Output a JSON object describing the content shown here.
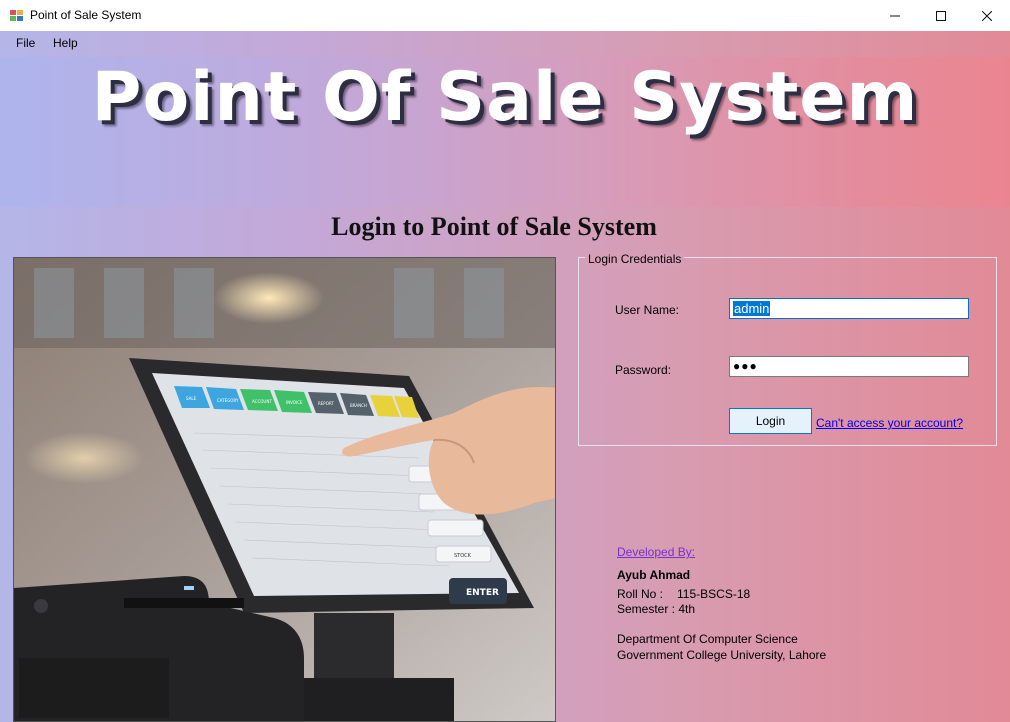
{
  "window": {
    "title": "Point of Sale System",
    "controls": {
      "minimize": "—",
      "maximize": "☐",
      "close": "✕"
    }
  },
  "menu": {
    "file": "File",
    "help": "Help"
  },
  "banner": {
    "title": "Point Of Sale System"
  },
  "heading": "Login to Point of Sale System",
  "login": {
    "group_label": "Login Credentials",
    "username_label": "User Name:",
    "username_value": "admin",
    "password_label": "Password:",
    "password_value": "●●●",
    "login_button": "Login",
    "help_link": "Can't access your account?"
  },
  "developer": {
    "heading": "Developed By:",
    "name": "Ayub Ahmad",
    "roll_label": "Roll No :",
    "roll_value": "115-BSCS-18",
    "semester": "Semester : 4th",
    "department": "Department Of Computer Science",
    "university": "Government College University, Lahore"
  },
  "pos_screen": {
    "tiles": [
      "SALE",
      "CATEGORY",
      "ACCOUNT",
      "INVOICE",
      "REPORT",
      "BRANCH",
      "ANY",
      ""
    ],
    "side_buttons": [
      "BARCO..",
      "PRICE",
      "LOCATION",
      "STOCK"
    ],
    "enter_label": "ENTER"
  },
  "colors": {
    "accent": "#0078d7",
    "link": "#0000ee",
    "dev_heading": "#7b2fd0"
  }
}
